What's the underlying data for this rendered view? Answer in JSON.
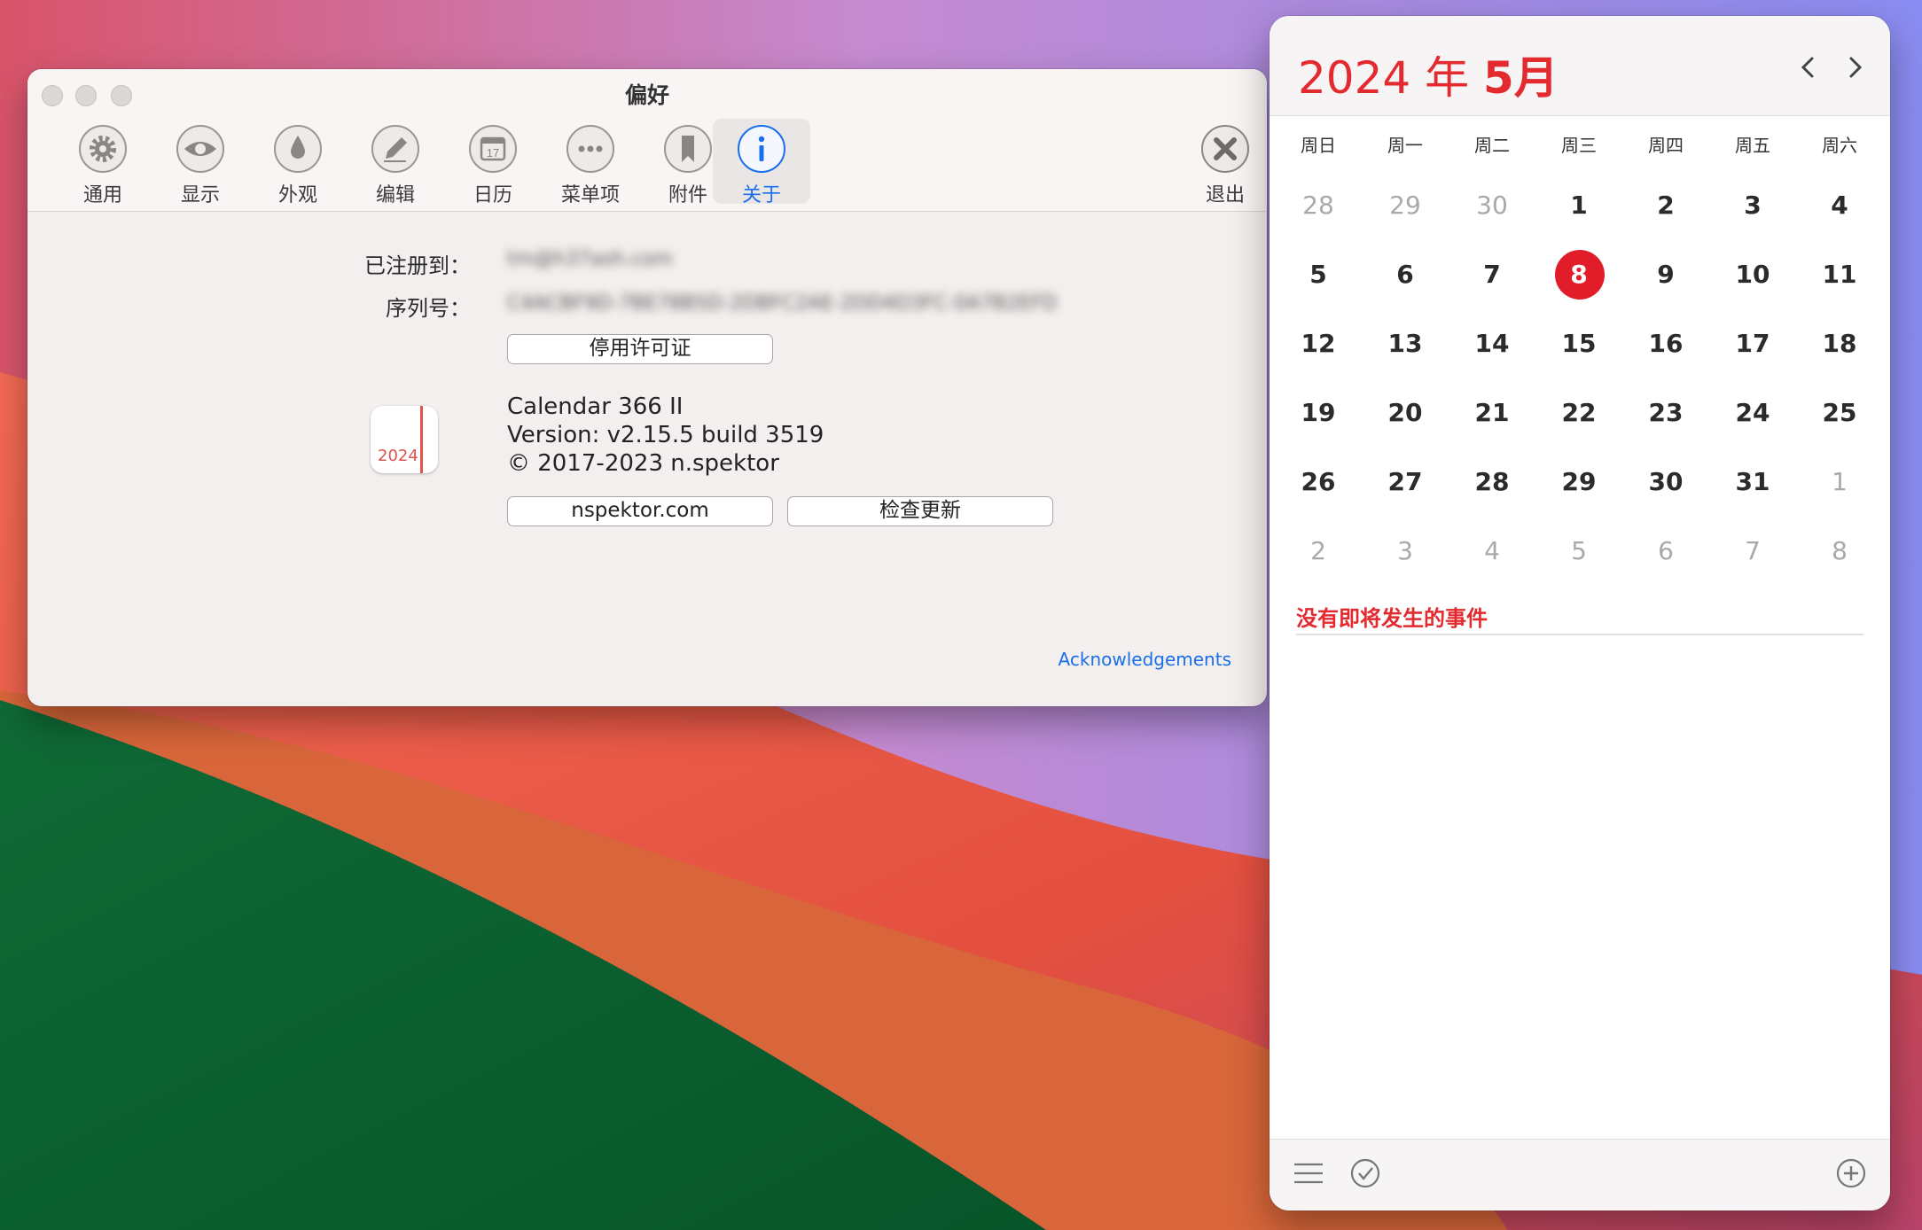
{
  "window": {
    "title": "偏好",
    "toolbar": [
      {
        "label": "通用",
        "icon": "gear-icon"
      },
      {
        "label": "显示",
        "icon": "eye-icon"
      },
      {
        "label": "外观",
        "icon": "drop-icon"
      },
      {
        "label": "编辑",
        "icon": "pencil-icon"
      },
      {
        "label": "日历",
        "icon": "calendar-17-icon"
      },
      {
        "label": "菜单项",
        "icon": "ellipsis-icon"
      },
      {
        "label": "附件",
        "icon": "bookmark-icon"
      },
      {
        "label": "关于",
        "icon": "info-icon",
        "active": true
      }
    ],
    "quit_label": "退出",
    "registered_label": "已注册到：",
    "registered_value": "tm@h37ash.com",
    "serial_label": "序列号：",
    "serial_value": "C4ACBF9D-7BE78B5D-2DBFC2AE-2DD4D3FC-0A7B2EFD",
    "deactivate_button": "停用许可证",
    "app_icon_year": "2024",
    "app_name": "Calendar 366 II",
    "version": "Version: v2.15.5 build 3519",
    "copyright": "© 2017-2023 n.spektor",
    "website_button": "nspektor.com",
    "update_button": "检查更新",
    "acknowledgements_link": "Acknowledgements"
  },
  "calendar": {
    "year_text": "2024 年 ",
    "month_text": "5月",
    "weekdays": [
      "周日",
      "周一",
      "周二",
      "周三",
      "周四",
      "周五",
      "周六"
    ],
    "weeks": [
      [
        "28",
        "29",
        "30",
        "1",
        "2",
        "3",
        "4"
      ],
      [
        "5",
        "6",
        "7",
        "8",
        "9",
        "10",
        "11"
      ],
      [
        "12",
        "13",
        "14",
        "15",
        "16",
        "17",
        "18"
      ],
      [
        "19",
        "20",
        "21",
        "22",
        "23",
        "24",
        "25"
      ],
      [
        "26",
        "27",
        "28",
        "29",
        "30",
        "31",
        "1"
      ],
      [
        "2",
        "3",
        "4",
        "5",
        "6",
        "7",
        "8"
      ]
    ],
    "today": "8",
    "no_events": "没有即将发生的事件",
    "accent_color": "#e22a2f"
  }
}
